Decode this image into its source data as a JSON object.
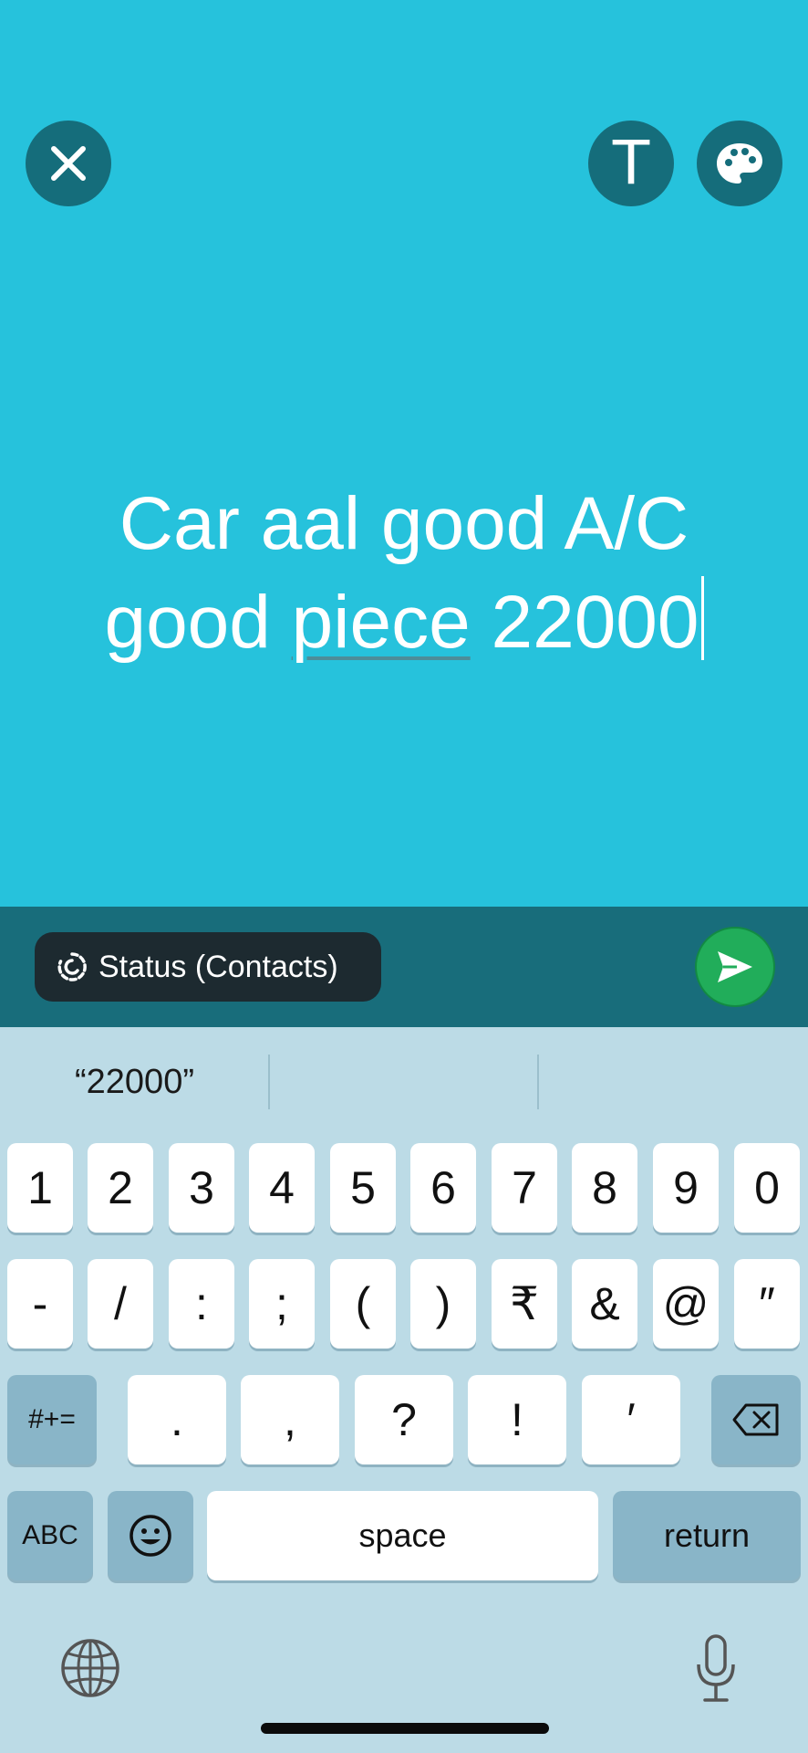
{
  "status": {
    "line1": "Car aal good A/C",
    "line2_before": "good ",
    "line2_underlined": "piece",
    "line2_after": " 22000"
  },
  "header": {
    "text_button_label": "T"
  },
  "audience": {
    "label": "Status (Contacts)"
  },
  "suggestions": [
    "“22000”",
    "",
    ""
  ],
  "keyboard": {
    "row1": [
      "1",
      "2",
      "3",
      "4",
      "5",
      "6",
      "7",
      "8",
      "9",
      "0"
    ],
    "row2": [
      "-",
      "/",
      ":",
      ";",
      "(",
      ")",
      "₹",
      "&",
      "@",
      "″"
    ],
    "row3": [
      ".",
      ",",
      "?",
      "!",
      "′"
    ],
    "symbols_label": "#+=",
    "abc_label": "ABC",
    "space_label": "space",
    "return_label": "return"
  },
  "colors": {
    "canvas": "#26c2dc",
    "toolbar": "#186d7b",
    "send": "#21ad5a",
    "keyboard": "#bcdbe6"
  }
}
